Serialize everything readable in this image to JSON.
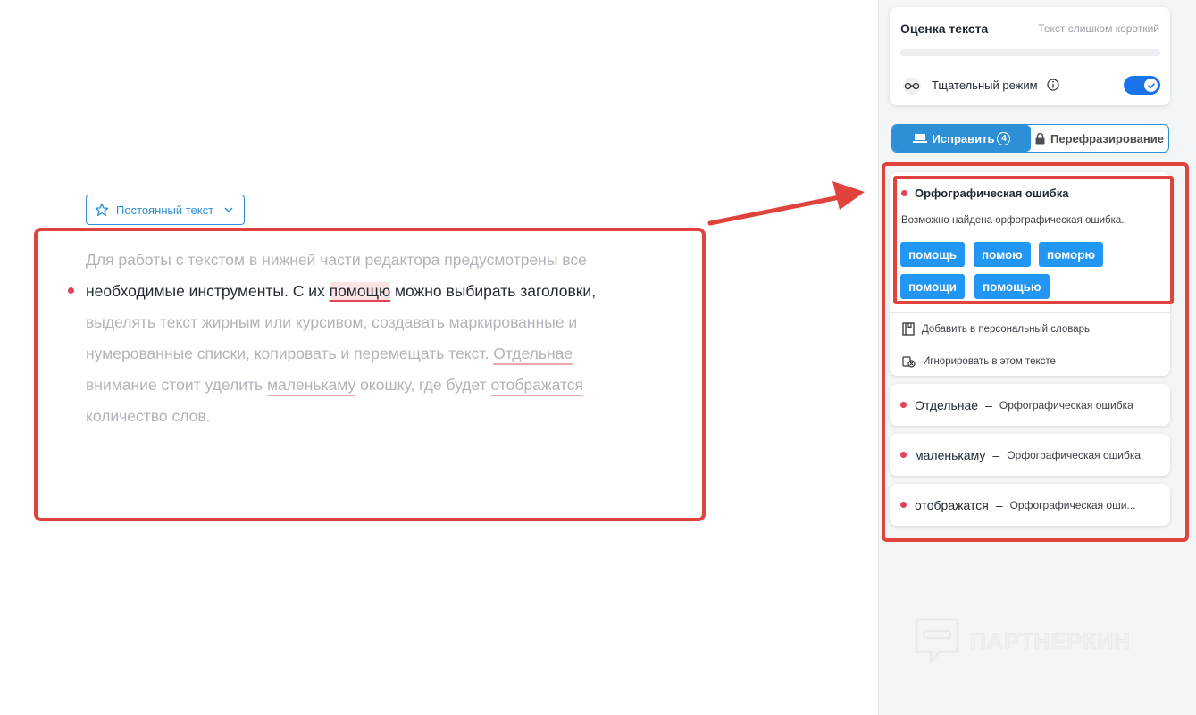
{
  "editor": {
    "tone_button_label": "Постоянный текст",
    "paragraph": {
      "line1": "Для работы с текстом в нижней части редактора предусмотрены все",
      "line2_a": "необходимые инструменты. С их ",
      "line2_err": "помощю",
      "line2_b": " можно выбирать заголовки,",
      "line3": "выделять текст жирным или курсивом, создавать маркированные и",
      "line4_a": "нумерованные списки, копировать и перемещать текст. ",
      "line4_err": "Отдельнае",
      "line5_a": "внимание стоит уделить ",
      "line5_err1": "маленькаму",
      "line5_b": " окошку, где будет ",
      "line5_err2": "отображатся",
      "line6": "количество слов."
    }
  },
  "score": {
    "title": "Оценка текста",
    "status": "Текст слишком короткий",
    "progress": 0,
    "mode_label": "Тщательный режим",
    "mode_enabled": true
  },
  "tabs": {
    "fix_label": "Исправить",
    "fix_count": "4",
    "rephrase_label": "Перефразирование"
  },
  "active_issue": {
    "title": "Орфографическая ошибка",
    "description": "Возможно найдена орфографическая ошибка.",
    "suggestions": [
      "помощь",
      "помою",
      "поморю",
      "помощи",
      "помощью"
    ],
    "add_dictionary_label": "Добавить в персональный словарь",
    "ignore_label": "Игнорировать в этом тексте"
  },
  "issues": [
    {
      "word": "Отдельнае",
      "sep": "–",
      "type": "Орфографическая ошибка"
    },
    {
      "word": "маленькаму",
      "sep": "–",
      "type": "Орфографическая ошибка"
    },
    {
      "word": "отображатся",
      "sep": "–",
      "type": "Орфографическая оши..."
    }
  ],
  "watermark": {
    "text": "ПАРТНЕРКИН"
  },
  "colors": {
    "accent": "#2d8fd6",
    "error": "#e0435a",
    "annotation_red": "#e0433b"
  }
}
